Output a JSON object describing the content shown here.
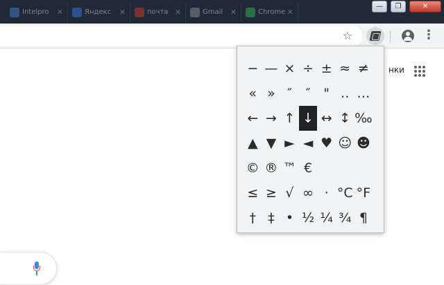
{
  "tabs": [
    {
      "title": "Intelpro",
      "favicon_color": "#4a76c4"
    },
    {
      "title": "Яндекс",
      "favicon_color": "#3b6fd6"
    },
    {
      "title": "почта",
      "favicon_color": "#c0392b"
    },
    {
      "title": "Gmail",
      "favicon_color": "#7f8c8d"
    },
    {
      "title": "Chrome",
      "favicon_color": "#34a853"
    }
  ],
  "window_controls": {
    "minimize": "—",
    "maximize": "❐",
    "close": "✕"
  },
  "toolbar": {
    "bookmark_star": "☆",
    "menu": "⋮"
  },
  "page": {
    "header_link_fragment": "нки"
  },
  "symbol_popup": {
    "selected": "↓",
    "rows": [
      [
        "−",
        "—",
        "×",
        "÷",
        "±",
        "≈",
        "≠"
      ],
      [
        "«",
        "»",
        "″",
        "″",
        "\"",
        "‥",
        "…"
      ],
      [
        "←",
        "→",
        "↑",
        "↓",
        "↔",
        "↕",
        "‰"
      ],
      [
        "▲",
        "▼",
        "►",
        "◄",
        "♥",
        "☺",
        "☻"
      ],
      [
        "©",
        "®",
        "™",
        "€",
        "",
        "",
        ""
      ],
      [
        "≤",
        "≥",
        "√",
        "∞",
        "·",
        "°C",
        "°F"
      ],
      [
        "†",
        "‡",
        "•",
        "½",
        "¼",
        "¾",
        "¶"
      ]
    ]
  },
  "colors": {
    "tabstrip": "#1f2a36",
    "toolbar": "#f1f3f4",
    "popup_bg": "#f1f3f4",
    "selected_bg": "#202124"
  }
}
